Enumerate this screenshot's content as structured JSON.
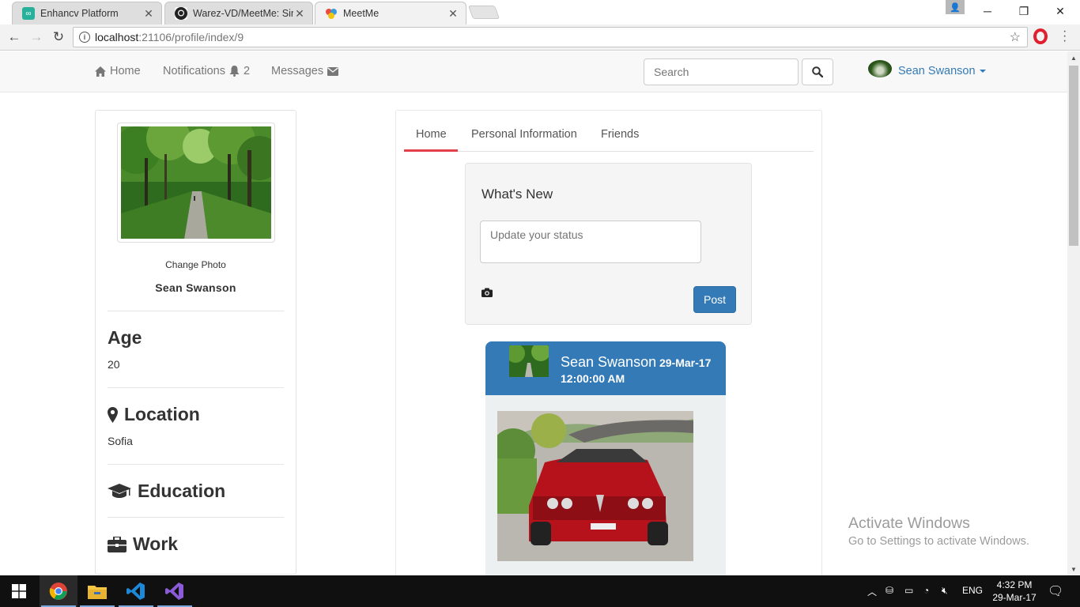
{
  "browser": {
    "tabs": [
      {
        "title": "Enhancv Platform",
        "icon": "enhancv-icon"
      },
      {
        "title": "Warez-VD/MeetMe: Simp",
        "icon": "github-icon"
      },
      {
        "title": "MeetMe",
        "icon": "meetme-icon"
      }
    ],
    "url_host": "localhost",
    "url_path": ":21106/profile/index/9"
  },
  "nav": {
    "home": "Home",
    "notifications": "Notifications",
    "notifications_count": "2",
    "messages": "Messages",
    "search_placeholder": "Search",
    "user_name": "Sean Swanson"
  },
  "profile": {
    "change_photo": "Change Photo",
    "name": "Sean Swanson",
    "age_label": "Age",
    "age_value": "20",
    "location_label": "Location",
    "location_value": "Sofia",
    "education_label": "Education",
    "work_label": "Work"
  },
  "tabs": [
    "Home",
    "Personal Information",
    "Friends"
  ],
  "composer": {
    "title": "What's New",
    "placeholder": "Update your status",
    "post_button": "Post"
  },
  "post": {
    "author": "Sean Swanson",
    "date": "29-Mar-17",
    "time": "12:00:00 AM"
  },
  "watermark": {
    "line1": "Activate Windows",
    "line2": "Go to Settings to activate Windows."
  },
  "taskbar": {
    "language": "ENG",
    "time": "4:32 PM",
    "date": "29-Mar-17"
  },
  "colors": {
    "brand_blue": "#337ab7",
    "tab_accent": "#e4404b",
    "taskbar": "#101010"
  }
}
